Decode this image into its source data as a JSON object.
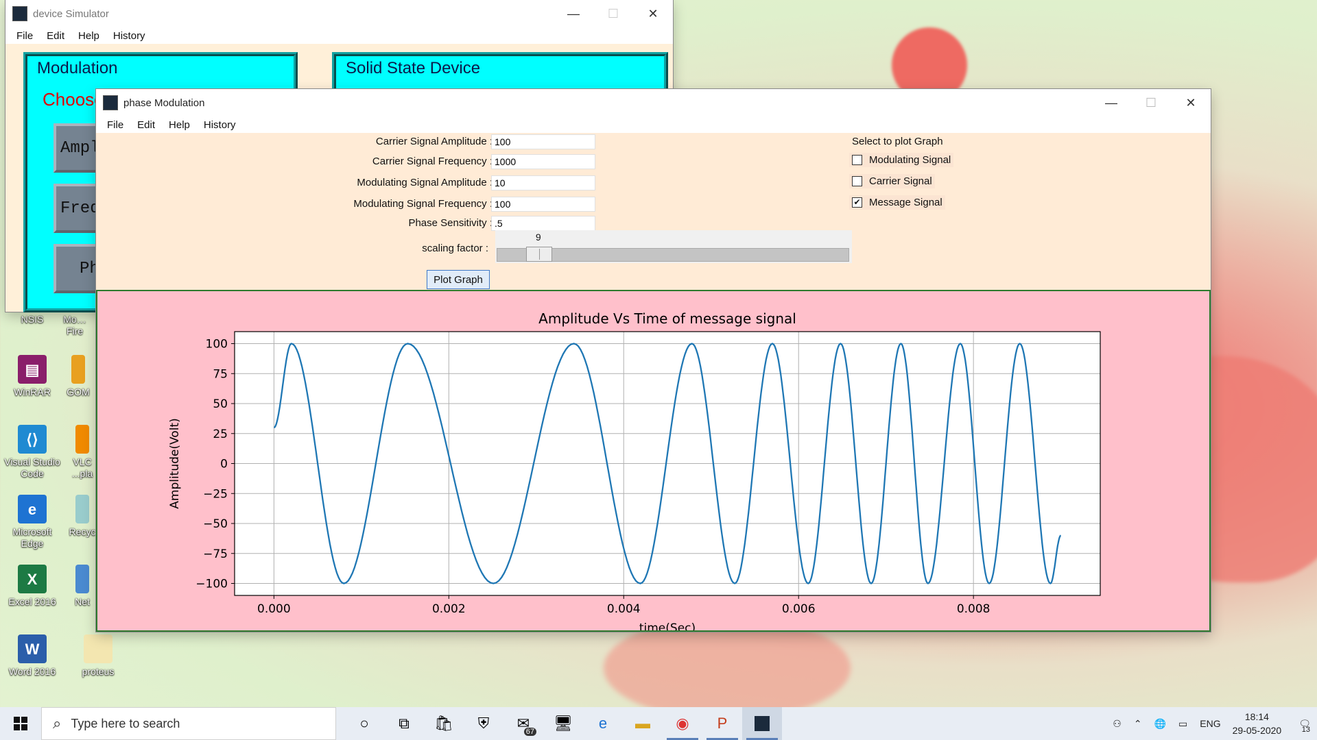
{
  "desktop": {
    "icons": [
      {
        "label": "NSIS",
        "icon": "nsis-icon"
      },
      {
        "label": "Mo… Fire",
        "icon": "firefox-icon"
      },
      {
        "label": "WinRAR",
        "icon": "winrar-icon"
      },
      {
        "label": "GOM",
        "icon": "gom-player-icon"
      },
      {
        "label": "Visual Studio Code",
        "icon": "vscode-icon"
      },
      {
        "label": "VLC ...pla",
        "icon": "vlc-icon"
      },
      {
        "label": "Microsoft Edge",
        "icon": "edge-icon"
      },
      {
        "label": "Recyc",
        "icon": "recycle-bin-icon"
      },
      {
        "label": "Excel 2016",
        "icon": "excel-icon"
      },
      {
        "label": "Net",
        "icon": "network-icon"
      },
      {
        "label": "Word 2016",
        "icon": "word-icon"
      },
      {
        "label": "proteus",
        "icon": "folder-icon"
      }
    ]
  },
  "device_simulator": {
    "title": "device Simulator",
    "menu": [
      "File",
      "Edit",
      "Help",
      "History"
    ],
    "modulation_panel": {
      "heading": "Modulation",
      "subheading": "Choose",
      "buttons": [
        "Ampl",
        "Freq",
        "Ph"
      ]
    },
    "solid_state_panel": {
      "heading": "Solid State Device"
    }
  },
  "phase_modulation": {
    "title": "phase Modulation",
    "menu": [
      "File",
      "Edit",
      "Help",
      "History"
    ],
    "form": {
      "carrier_amplitude": {
        "label": "Carrier Signal Amplitude :",
        "value": "100"
      },
      "carrier_frequency": {
        "label": "Carrier Signal Frequency :",
        "value": "1000"
      },
      "modulating_amplitude": {
        "label": "Modulating Signal Amplitude :",
        "value": "10"
      },
      "modulating_frequency": {
        "label": "Modulating Signal Frequency :",
        "value": "100"
      },
      "phase_sensitivity": {
        "label": "Phase Sensitivity :",
        "value": ".5"
      }
    },
    "scaling": {
      "label": "scaling factor :",
      "value": "9",
      "level": 9,
      "max": 100
    },
    "plot_button": "Plot Graph",
    "select": {
      "heading": "Select to plot Graph",
      "options": [
        {
          "label": "Modulating Signal",
          "checked": false
        },
        {
          "label": "Carrier Signal",
          "checked": false
        },
        {
          "label": "Message Signal",
          "checked": true
        }
      ]
    }
  },
  "chart_data": {
    "type": "line",
    "title": "Amplitude Vs Time of message signal",
    "xlabel": "time(Sec)",
    "ylabel": "Amplitude(Volt)",
    "xlim": [
      -0.00045,
      0.00945
    ],
    "ylim": [
      -110,
      110
    ],
    "xticks": [
      "0.000",
      "0.002",
      "0.004",
      "0.006",
      "0.008"
    ],
    "xtick_values": [
      0,
      0.002,
      0.004,
      0.006,
      0.008
    ],
    "yticks": [
      "100",
      "75",
      "50",
      "25",
      "0",
      "−25",
      "−50",
      "−75",
      "−100"
    ],
    "ytick_values": [
      100,
      75,
      50,
      25,
      0,
      -25,
      -50,
      -75,
      -100
    ],
    "grid": true,
    "line_color": "#1f77b4",
    "series": [
      {
        "x": [
          0,
          0.0002,
          0.0008,
          0.00153,
          0.00251,
          0.00343,
          0.00419,
          0.00478,
          0.00527,
          0.0057,
          0.00611,
          0.00648,
          0.00683,
          0.00717,
          0.00748,
          0.00785,
          0.00818,
          0.00853,
          0.00888,
          0.009
        ],
        "y": [
          30,
          100,
          -100,
          100,
          -100,
          100,
          -100,
          100,
          -100,
          100,
          -100,
          100,
          -100,
          100,
          -100,
          100,
          -100,
          100,
          -100,
          -60
        ]
      }
    ]
  },
  "taskbar": {
    "search_placeholder": "Type here to search",
    "mail_badge": "67",
    "language": "ENG",
    "time": "18:14",
    "date": "29-05-2020",
    "notifications": "13"
  }
}
